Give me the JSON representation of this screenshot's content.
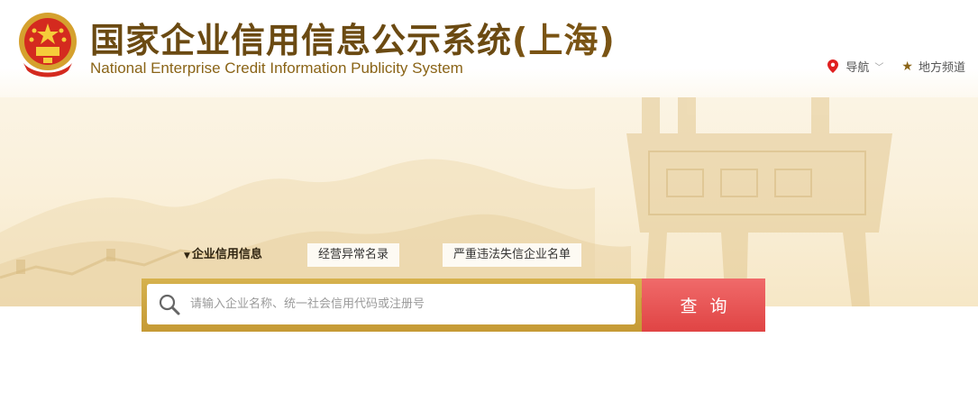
{
  "header": {
    "title_cn": "国家企业信用信息公示系统",
    "title_region": "(上海)",
    "title_en": "National Enterprise Credit Information Publicity System"
  },
  "nav": {
    "guide_label": "导航",
    "local_channel_label": "地方频道"
  },
  "tabs": [
    {
      "label": "企业信用信息",
      "active": true
    },
    {
      "label": "经营异常名录",
      "active": false
    },
    {
      "label": "严重违法失信企业名单",
      "active": false
    }
  ],
  "search": {
    "placeholder": "请输入企业名称、统一社会信用代码或注册号",
    "value": "",
    "button_label": "查询"
  },
  "colors": {
    "brand_brown": "#6b4a12",
    "gold": "#c59a35",
    "button_red": "#e04444",
    "pin_red": "#e02020"
  },
  "icons": [
    "national-emblem-icon",
    "location-pin-icon",
    "chevron-down-icon",
    "star-icon",
    "search-icon"
  ]
}
